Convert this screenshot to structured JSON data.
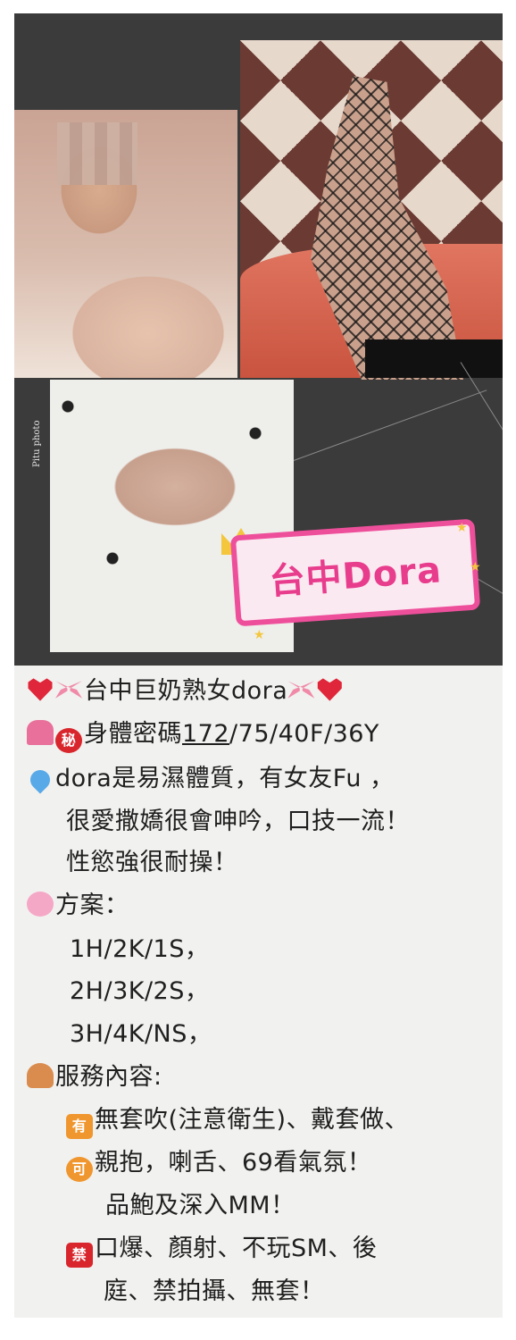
{
  "collage": {
    "watermark": "Pitu photo",
    "badge_text": "台中Dora"
  },
  "post": {
    "title": "台中巨奶熟女dora",
    "stats_prefix": "身體密碼",
    "stats_underlined": "172",
    "stats_rest": "/75/40F/36Y",
    "desc_line1": "dora是易濕體質，有女友Fu ，",
    "desc_line2": "很愛撒嬌很會呻吟，口技一流！",
    "desc_line3": "性慾強很耐操！",
    "plans_heading": "方案：",
    "plan1": "1H/2K/1S，",
    "plan2": "2H/3K/2S，",
    "plan3": "3H/4K/NS，",
    "service_heading": "服務內容:",
    "yes_line": "無套吹(注意衛生)、戴套做、",
    "ok_line": "親抱，喇舌、69看氣氛！",
    "ok_line2": "品鮑及深入MM！",
    "no_line1": "口爆、顏射、不玩SM、後",
    "no_line2": "庭、禁拍攝、無套！",
    "badge_secret": "秘",
    "badge_yes": "有",
    "badge_ok": "可",
    "badge_no": "禁"
  },
  "icons": [
    "heart-icon",
    "ribbon-icon",
    "bikini-icon",
    "secret-badge-icon",
    "sweat-drops-icon",
    "cherry-blossom-icon",
    "person-tipping-hand-icon"
  ],
  "colors": {
    "collage_bg": "#3b3b3b",
    "badge_pink": "#e83c8c",
    "text_bg": "#f1f1ef"
  }
}
